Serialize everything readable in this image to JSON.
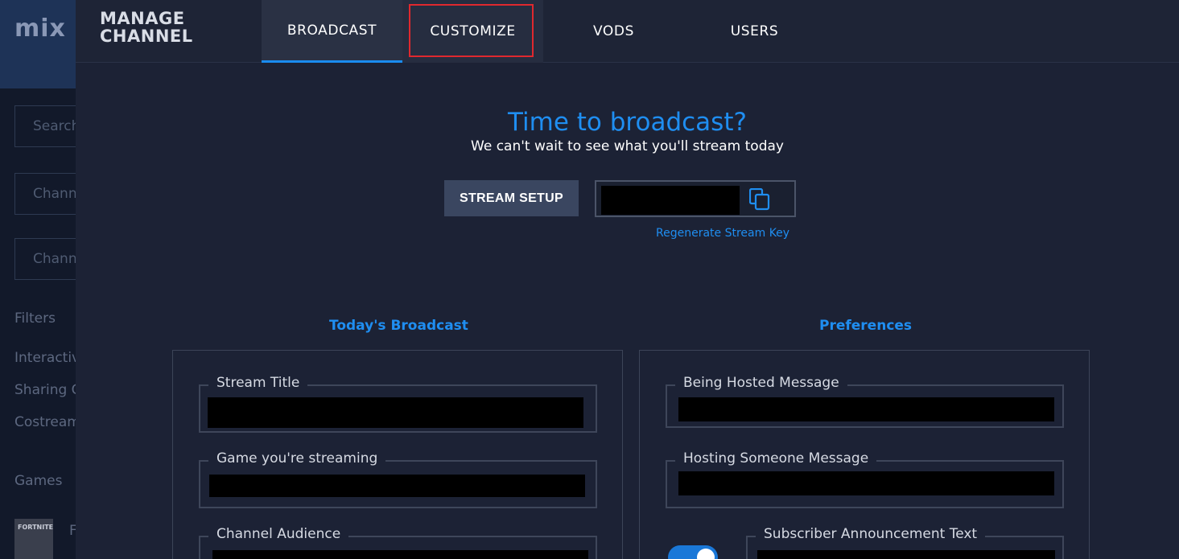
{
  "sidebar": {
    "logo": "mix",
    "search_placeholder": "Search",
    "channel_filter_1": "Channels",
    "channel_filter_2": "Channels",
    "filters_label": "Filters",
    "filter_items": [
      "Interactive",
      "Sharing Controller",
      "Costream"
    ],
    "games_label": "Games",
    "game_thumb_text": "FORTNITE",
    "game_label": "F"
  },
  "header": {
    "title_line1": "MANAGE",
    "title_line2": "CHANNEL",
    "tabs": [
      {
        "label": "BROADCAST",
        "active": true
      },
      {
        "label": "CUSTOMIZE",
        "active": false,
        "highlighted": true
      },
      {
        "label": "VODS",
        "active": false
      },
      {
        "label": "USERS",
        "active": false
      }
    ]
  },
  "hero": {
    "title": "Time to broadcast?",
    "subtitle": "We can't wait to see what you'll stream today"
  },
  "stream": {
    "setup_button": "STREAM SETUP",
    "regenerate_link": "Regenerate Stream Key",
    "copy_icon": "copy-icon"
  },
  "todays_broadcast": {
    "heading": "Today's Broadcast",
    "fields": [
      "Stream Title",
      "Game you're streaming",
      "Channel Audience"
    ]
  },
  "preferences": {
    "heading": "Preferences",
    "fields": [
      "Being Hosted Message",
      "Hosting Someone Message",
      "Subscriber Announcement Text"
    ],
    "toggle_on": true
  },
  "colors": {
    "accent": "#1f8ef1",
    "background": "#1c2235",
    "highlight_box": "#e0282e"
  }
}
